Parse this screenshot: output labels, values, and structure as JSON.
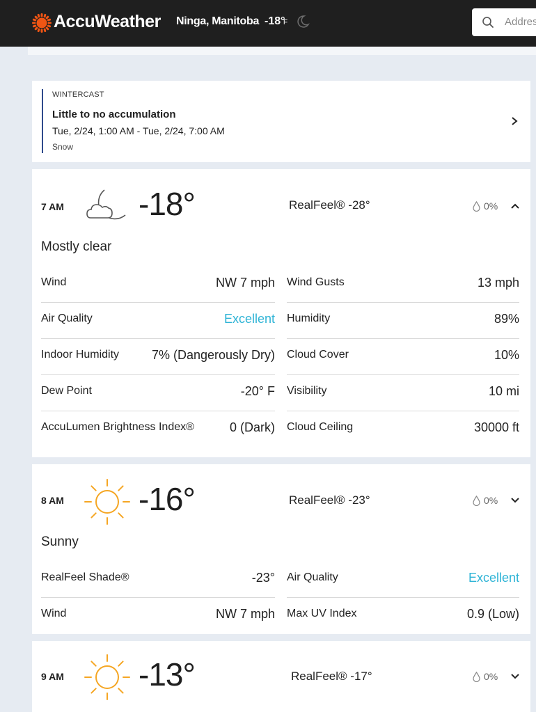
{
  "header": {
    "brand": "AccuWeather",
    "location": "Ninga, Manitoba",
    "current_temp": "-18°",
    "temp_unit": "F",
    "search_placeholder": "Address"
  },
  "wintercast": {
    "label": "WINTERCAST",
    "title": "Little to no accumulation",
    "time_range": "Tue, 2/24, 1:00 AM - Tue, 2/24, 7:00 AM",
    "type": "Snow"
  },
  "hours": [
    {
      "time": "7 AM",
      "icon": "moon-cloud-icon",
      "temp": "-18°",
      "realfeel": "RealFeel® -28°",
      "precip": "0%",
      "expanded": true,
      "phrase": "Mostly clear",
      "details": [
        {
          "left_label": "Wind",
          "left_value": "NW 7 mph",
          "right_label": "Wind Gusts",
          "right_value": "13 mph"
        },
        {
          "left_label": "Air Quality",
          "left_value": "Excellent",
          "right_label": "Humidity",
          "right_value": "89%"
        },
        {
          "left_label": "Indoor Humidity",
          "left_value": "7% (Dangerously Dry)",
          "right_label": "Cloud Cover",
          "right_value": "10%"
        },
        {
          "left_label": "Dew Point",
          "left_value": "-20° F",
          "right_label": "Visibility",
          "right_value": "10 mi"
        },
        {
          "left_label": "AccuLumen Brightness Index®",
          "left_value": "0 (Dark)",
          "right_label": "Cloud Ceiling",
          "right_value": "30000 ft"
        }
      ]
    },
    {
      "time": "8 AM",
      "icon": "sun-icon",
      "temp": "-16°",
      "realfeel": "RealFeel® -23°",
      "precip": "0%",
      "expanded": false,
      "phrase": "Sunny",
      "details": [
        {
          "left_label": "RealFeel Shade®",
          "left_value": "-23°",
          "right_label": "Air Quality",
          "right_value": "Excellent"
        },
        {
          "left_label": "Wind",
          "left_value": "NW 7 mph",
          "right_label": "Max UV Index",
          "right_value": "0.9 (Low)"
        }
      ]
    },
    {
      "time": "9 AM",
      "icon": "sun-icon",
      "temp": "-13°",
      "realfeel": "RealFeel® -17°",
      "precip": "0%",
      "expanded": false
    }
  ],
  "colors": {
    "brand_orange": "#f05514",
    "accent_blue": "#2fb4d6",
    "sun_orange": "#f5a623",
    "header_bg": "#1f1f1f",
    "page_bg": "#e6ebf2"
  }
}
